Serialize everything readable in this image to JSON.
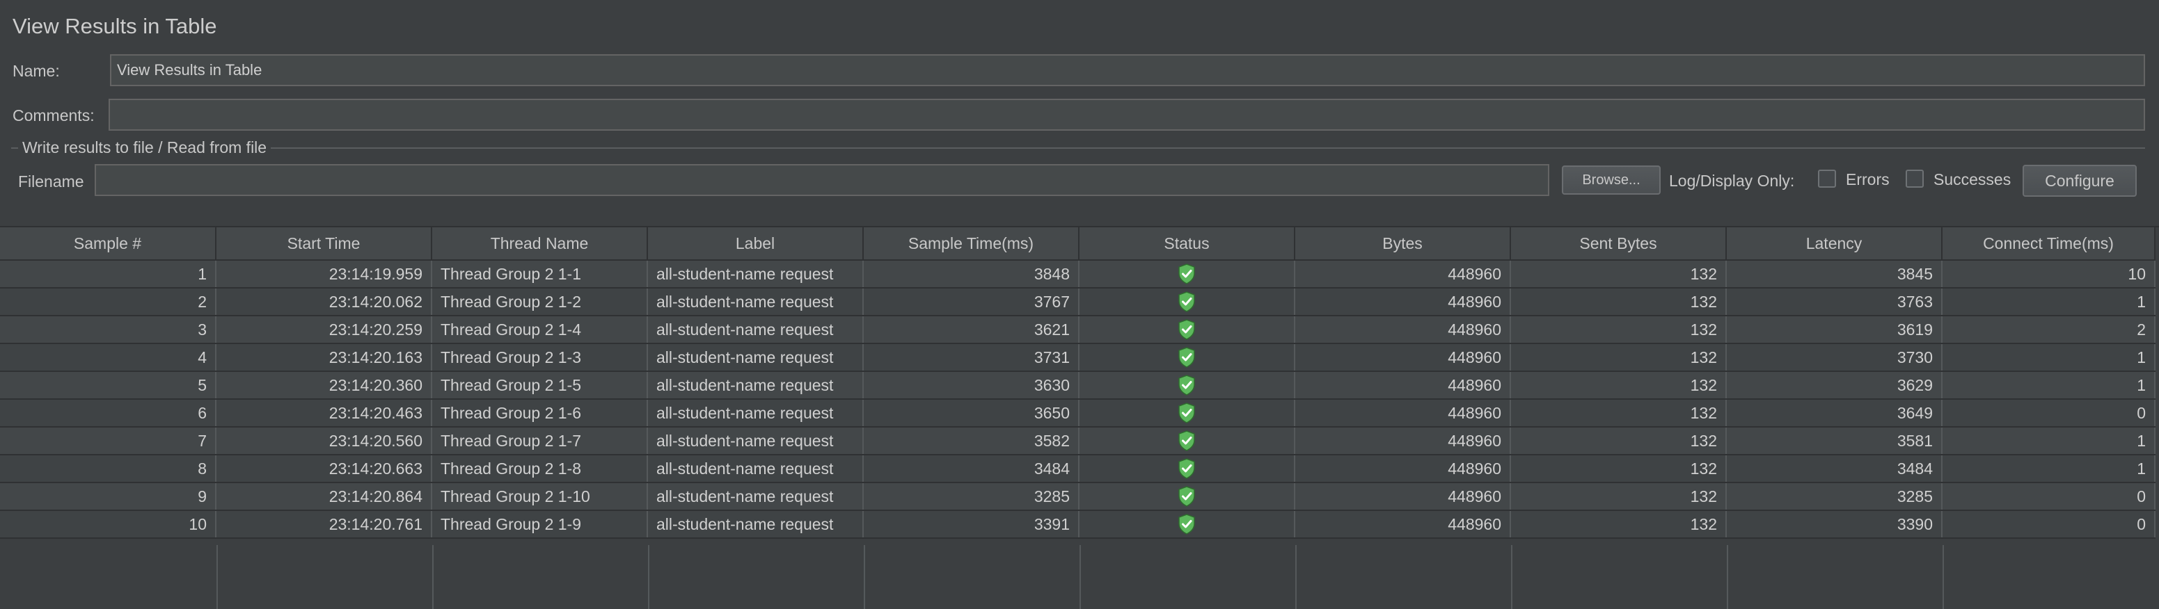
{
  "panel": {
    "title": "View Results in Table",
    "name_label": "Name:",
    "name_value": "View Results in Table",
    "comments_label": "Comments:",
    "comments_value": "",
    "file_group_title": "Write results to file / Read from file",
    "filename_label": "Filename",
    "filename_value": "",
    "browse_label": "Browse...",
    "log_display_label": "Log/Display Only:",
    "errors_label": "Errors",
    "successes_label": "Successes",
    "configure_label": "Configure"
  },
  "table": {
    "columns": [
      "Sample #",
      "Start Time",
      "Thread Name",
      "Label",
      "Sample Time(ms)",
      "Status",
      "Bytes",
      "Sent Bytes",
      "Latency",
      "Connect Time(ms)"
    ],
    "status_icon": "success-shield-icon",
    "colors": {
      "success": "#5cb85c"
    },
    "rows": [
      [
        "1",
        "23:14:19.959",
        "Thread Group 2 1-1",
        "all-student-name request",
        "3848",
        "",
        "448960",
        "132",
        "3845",
        "10"
      ],
      [
        "2",
        "23:14:20.062",
        "Thread Group 2 1-2",
        "all-student-name request",
        "3767",
        "",
        "448960",
        "132",
        "3763",
        "1"
      ],
      [
        "3",
        "23:14:20.259",
        "Thread Group 2 1-4",
        "all-student-name request",
        "3621",
        "",
        "448960",
        "132",
        "3619",
        "2"
      ],
      [
        "4",
        "23:14:20.163",
        "Thread Group 2 1-3",
        "all-student-name request",
        "3731",
        "",
        "448960",
        "132",
        "3730",
        "1"
      ],
      [
        "5",
        "23:14:20.360",
        "Thread Group 2 1-5",
        "all-student-name request",
        "3630",
        "",
        "448960",
        "132",
        "3629",
        "1"
      ],
      [
        "6",
        "23:14:20.463",
        "Thread Group 2 1-6",
        "all-student-name request",
        "3650",
        "",
        "448960",
        "132",
        "3649",
        "0"
      ],
      [
        "7",
        "23:14:20.560",
        "Thread Group 2 1-7",
        "all-student-name request",
        "3582",
        "",
        "448960",
        "132",
        "3581",
        "1"
      ],
      [
        "8",
        "23:14:20.663",
        "Thread Group 2 1-8",
        "all-student-name request",
        "3484",
        "",
        "448960",
        "132",
        "3484",
        "1"
      ],
      [
        "9",
        "23:14:20.864",
        "Thread Group 2 1-10",
        "all-student-name request",
        "3285",
        "",
        "448960",
        "132",
        "3285",
        "0"
      ],
      [
        "10",
        "23:14:20.761",
        "Thread Group 2 1-9",
        "all-student-name request",
        "3391",
        "",
        "448960",
        "132",
        "3390",
        "0"
      ]
    ]
  }
}
